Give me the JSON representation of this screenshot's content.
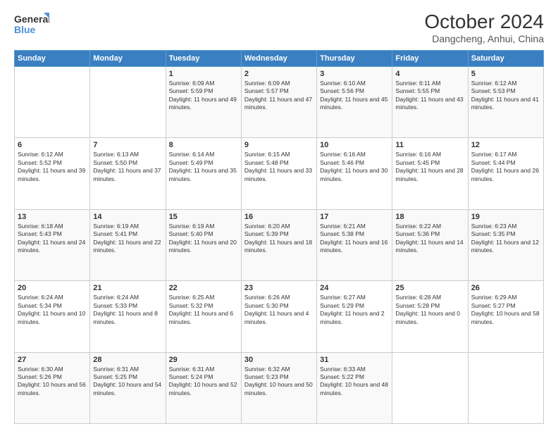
{
  "header": {
    "logo_line1": "General",
    "logo_line2": "Blue",
    "title": "October 2024",
    "subtitle": "Dangcheng, Anhui, China"
  },
  "weekdays": [
    "Sunday",
    "Monday",
    "Tuesday",
    "Wednesday",
    "Thursday",
    "Friday",
    "Saturday"
  ],
  "weeks": [
    [
      {
        "day": "",
        "info": ""
      },
      {
        "day": "",
        "info": ""
      },
      {
        "day": "1",
        "info": "Sunrise: 6:09 AM\nSunset: 5:59 PM\nDaylight: 11 hours and 49 minutes."
      },
      {
        "day": "2",
        "info": "Sunrise: 6:09 AM\nSunset: 5:57 PM\nDaylight: 11 hours and 47 minutes."
      },
      {
        "day": "3",
        "info": "Sunrise: 6:10 AM\nSunset: 5:56 PM\nDaylight: 11 hours and 45 minutes."
      },
      {
        "day": "4",
        "info": "Sunrise: 6:11 AM\nSunset: 5:55 PM\nDaylight: 11 hours and 43 minutes."
      },
      {
        "day": "5",
        "info": "Sunrise: 6:12 AM\nSunset: 5:53 PM\nDaylight: 11 hours and 41 minutes."
      }
    ],
    [
      {
        "day": "6",
        "info": "Sunrise: 6:12 AM\nSunset: 5:52 PM\nDaylight: 11 hours and 39 minutes."
      },
      {
        "day": "7",
        "info": "Sunrise: 6:13 AM\nSunset: 5:50 PM\nDaylight: 11 hours and 37 minutes."
      },
      {
        "day": "8",
        "info": "Sunrise: 6:14 AM\nSunset: 5:49 PM\nDaylight: 11 hours and 35 minutes."
      },
      {
        "day": "9",
        "info": "Sunrise: 6:15 AM\nSunset: 5:48 PM\nDaylight: 11 hours and 33 minutes."
      },
      {
        "day": "10",
        "info": "Sunrise: 6:16 AM\nSunset: 5:46 PM\nDaylight: 11 hours and 30 minutes."
      },
      {
        "day": "11",
        "info": "Sunrise: 6:16 AM\nSunset: 5:45 PM\nDaylight: 11 hours and 28 minutes."
      },
      {
        "day": "12",
        "info": "Sunrise: 6:17 AM\nSunset: 5:44 PM\nDaylight: 11 hours and 26 minutes."
      }
    ],
    [
      {
        "day": "13",
        "info": "Sunrise: 6:18 AM\nSunset: 5:43 PM\nDaylight: 11 hours and 24 minutes."
      },
      {
        "day": "14",
        "info": "Sunrise: 6:19 AM\nSunset: 5:41 PM\nDaylight: 11 hours and 22 minutes."
      },
      {
        "day": "15",
        "info": "Sunrise: 6:19 AM\nSunset: 5:40 PM\nDaylight: 11 hours and 20 minutes."
      },
      {
        "day": "16",
        "info": "Sunrise: 6:20 AM\nSunset: 5:39 PM\nDaylight: 11 hours and 18 minutes."
      },
      {
        "day": "17",
        "info": "Sunrise: 6:21 AM\nSunset: 5:38 PM\nDaylight: 11 hours and 16 minutes."
      },
      {
        "day": "18",
        "info": "Sunrise: 6:22 AM\nSunset: 5:36 PM\nDaylight: 11 hours and 14 minutes."
      },
      {
        "day": "19",
        "info": "Sunrise: 6:23 AM\nSunset: 5:35 PM\nDaylight: 11 hours and 12 minutes."
      }
    ],
    [
      {
        "day": "20",
        "info": "Sunrise: 6:24 AM\nSunset: 5:34 PM\nDaylight: 11 hours and 10 minutes."
      },
      {
        "day": "21",
        "info": "Sunrise: 6:24 AM\nSunset: 5:33 PM\nDaylight: 11 hours and 8 minutes."
      },
      {
        "day": "22",
        "info": "Sunrise: 6:25 AM\nSunset: 5:32 PM\nDaylight: 11 hours and 6 minutes."
      },
      {
        "day": "23",
        "info": "Sunrise: 6:26 AM\nSunset: 5:30 PM\nDaylight: 11 hours and 4 minutes."
      },
      {
        "day": "24",
        "info": "Sunrise: 6:27 AM\nSunset: 5:29 PM\nDaylight: 11 hours and 2 minutes."
      },
      {
        "day": "25",
        "info": "Sunrise: 6:28 AM\nSunset: 5:28 PM\nDaylight: 11 hours and 0 minutes."
      },
      {
        "day": "26",
        "info": "Sunrise: 6:29 AM\nSunset: 5:27 PM\nDaylight: 10 hours and 58 minutes."
      }
    ],
    [
      {
        "day": "27",
        "info": "Sunrise: 6:30 AM\nSunset: 5:26 PM\nDaylight: 10 hours and 56 minutes."
      },
      {
        "day": "28",
        "info": "Sunrise: 6:31 AM\nSunset: 5:25 PM\nDaylight: 10 hours and 54 minutes."
      },
      {
        "day": "29",
        "info": "Sunrise: 6:31 AM\nSunset: 5:24 PM\nDaylight: 10 hours and 52 minutes."
      },
      {
        "day": "30",
        "info": "Sunrise: 6:32 AM\nSunset: 5:23 PM\nDaylight: 10 hours and 50 minutes."
      },
      {
        "day": "31",
        "info": "Sunrise: 6:33 AM\nSunset: 5:22 PM\nDaylight: 10 hours and 48 minutes."
      },
      {
        "day": "",
        "info": ""
      },
      {
        "day": "",
        "info": ""
      }
    ]
  ]
}
